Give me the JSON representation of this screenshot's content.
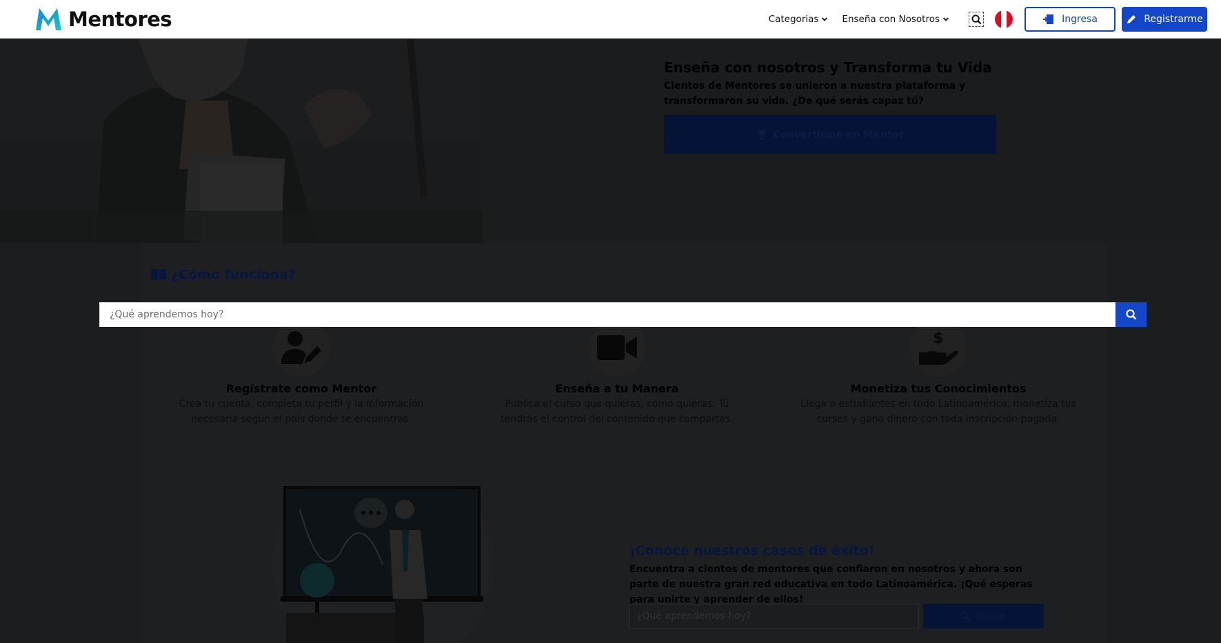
{
  "header": {
    "brand": "Mentores",
    "nav": [
      {
        "label": "Categorias"
      },
      {
        "label": "Enseña con Nosotros"
      }
    ],
    "login_label": "Ingresa",
    "register_label": "Registrarme"
  },
  "hero": {
    "title": "Enseña con nosotros y Transforma tu Vida",
    "text": "Cientos de Mentores se unieron a nuestra plataforma y transformaron su vida. ¿De qué serás capaz tú?",
    "cta_label": "Convertirme en Mentor"
  },
  "search": {
    "placeholder": "¿Qué aprendemos hoy?"
  },
  "como_funciona": {
    "title": "¿Cómo funciona?",
    "steps": [
      {
        "icon": "user-edit-icon",
        "title": "Regístrate como Mentor",
        "text": "Crea tu cuenta, completa tu perfil y la información necesaria según el país donde te encuentras."
      },
      {
        "icon": "video-camera-icon",
        "title": "Enseña a tu Manera",
        "text": "Publica el curso que quieras, como quieras. Tú tendrás el control del contenido que compartas."
      },
      {
        "icon": "hand-dollar-icon",
        "title": "Monetiza tus Conocimientos",
        "text": "Llega a estudiantes en todo Latinoamérica, monetiza tus cursos y gana dinero con toda inscripción pagada."
      }
    ]
  },
  "casos": {
    "title": "¡Conoce nuestros casos de éxito!",
    "text": "Encuentra a cientos de mentores que confiaron en nosotros y ahora son parte de nuestra gran red educativa en todo Latinoamérica. ¡Qué esperas para unirte y aprender de ellos!",
    "search_placeholder": "¿Qué aprendemos hoy?",
    "search_button": "Buscar"
  },
  "colors": {
    "brand_blue": "#1447c8",
    "overlay_dark": "#1e1f21"
  }
}
